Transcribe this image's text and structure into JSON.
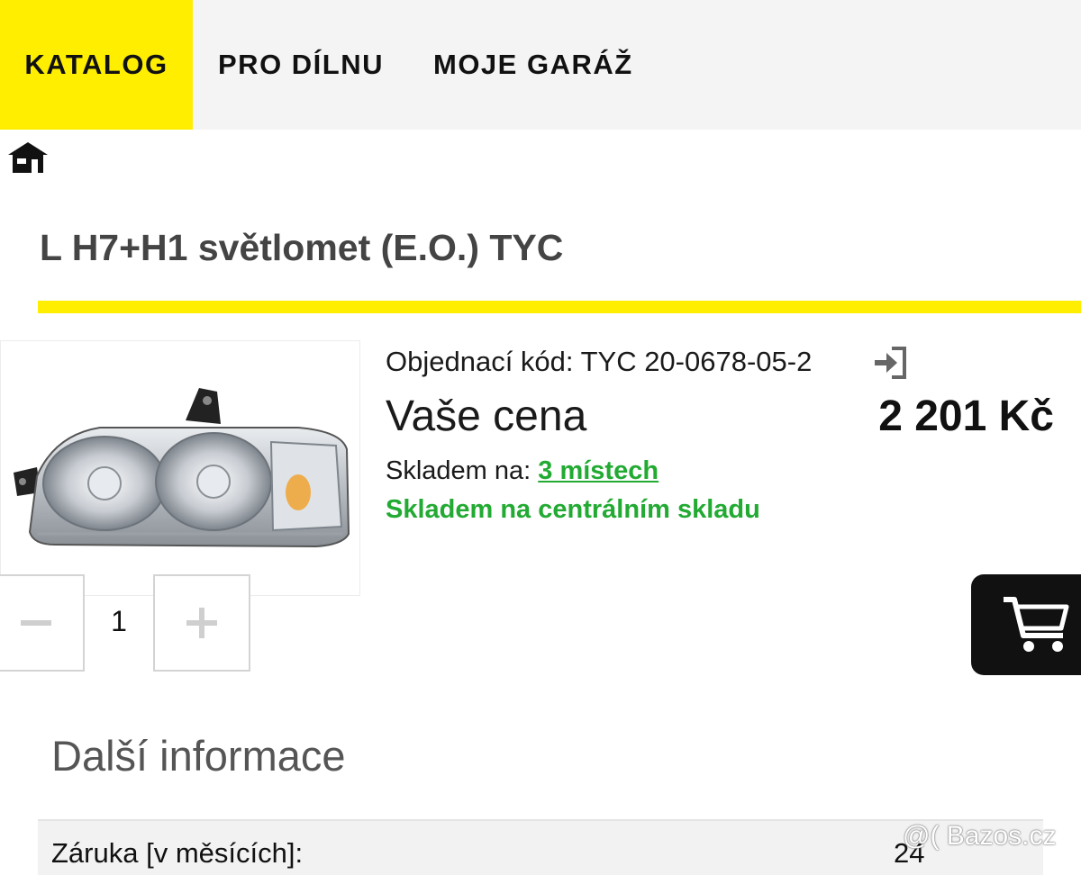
{
  "nav": {
    "tabs": [
      {
        "label": "KATALOG",
        "active": true
      },
      {
        "label": "PRO DÍLNU",
        "active": false
      },
      {
        "label": "MOJE GARÁŽ",
        "active": false
      }
    ]
  },
  "product": {
    "title": "L H7+H1 světlomet (E.O.) TYC",
    "order_code": "Objednací kód: TYC 20-0678-05-2",
    "price_label": "Vaše cena",
    "price_value": "2 201 Kč",
    "stock_prefix": "Skladem na: ",
    "stock_link": "3 místech",
    "stock_central": "Skladem na centrálním skladu",
    "quantity": "1"
  },
  "info": {
    "heading": "Další informace",
    "rows": [
      {
        "label": "Záruka [v měsících]:",
        "value": "24"
      }
    ]
  },
  "watermark": "@( Bazos.cz",
  "icons": [
    "home-icon",
    "login-icon",
    "minus-icon",
    "plus-icon",
    "cart-icon"
  ],
  "colors": {
    "accent_yellow": "#ffee00",
    "stock_green": "#22aa33",
    "cart_black": "#111111"
  }
}
